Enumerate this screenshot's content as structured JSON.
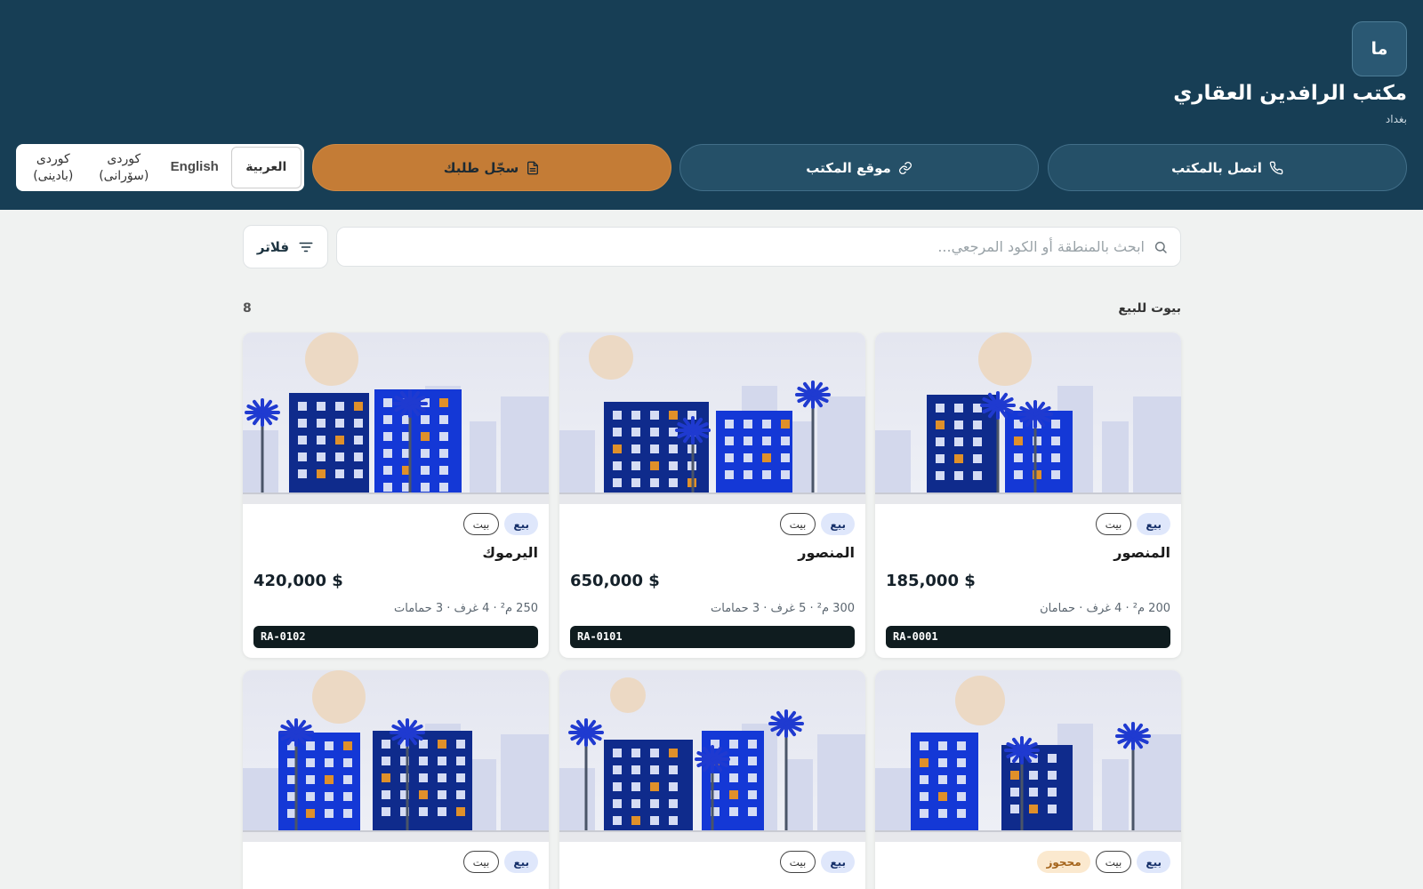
{
  "header": {
    "logo_text": "ما",
    "office_name": "مكتب الرافدين العقاري",
    "city": "بغداد",
    "buttons": {
      "call": "اتصل بالمكتب",
      "website": "موقع المكتب",
      "request": "سجّل طلبك"
    },
    "languages": [
      {
        "label": "العربية",
        "active": true
      },
      {
        "label": "English",
        "active": false
      },
      {
        "label": "كوردی (سۆرانی)",
        "active": false
      },
      {
        "label": "كوردی (بادینی)",
        "active": false
      }
    ],
    "accent_color": "#c47c36",
    "header_color": "#173e55"
  },
  "search": {
    "placeholder": "ابحث بالمنطقة أو الكود المرجعي...",
    "filters_label": "فلاتر"
  },
  "listing": {
    "title": "بيوت للبيع",
    "count": "8"
  },
  "cards": [
    {
      "sale": "بيع",
      "type": "بيت",
      "reserved": "",
      "location": "المنصور",
      "price": "185,000 $",
      "specs": "200 م² · 4 غرف · حمامان",
      "ref": "RA-0001"
    },
    {
      "sale": "بيع",
      "type": "بيت",
      "reserved": "",
      "location": "المنصور",
      "price": "650,000 $",
      "specs": "300 م² · 5 غرف · 3 حمامات",
      "ref": "RA-0101"
    },
    {
      "sale": "بيع",
      "type": "بيت",
      "reserved": "",
      "location": "اليرموك",
      "price": "420,000 $",
      "specs": "250 م² · 4 غرف · 3 حمامات",
      "ref": "RA-0102"
    },
    {
      "sale": "بيع",
      "type": "بيت",
      "reserved": "محجوز",
      "location": "",
      "price": "",
      "specs": "",
      "ref": ""
    },
    {
      "sale": "بيع",
      "type": "بيت",
      "reserved": "",
      "location": "",
      "price": "",
      "specs": "",
      "ref": ""
    },
    {
      "sale": "بيع",
      "type": "بيت",
      "reserved": "",
      "location": "",
      "price": "",
      "specs": "",
      "ref": ""
    }
  ]
}
